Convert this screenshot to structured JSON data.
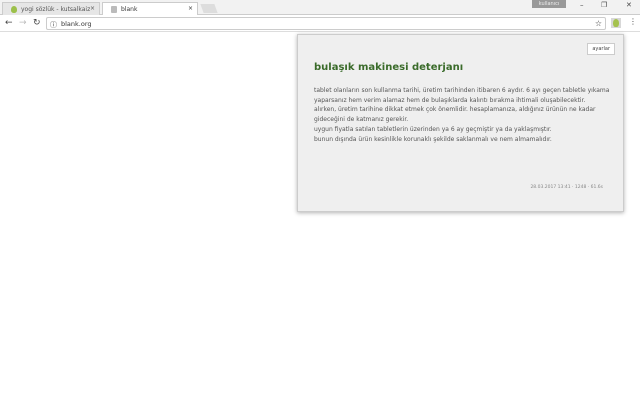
{
  "tabs": [
    {
      "label": "yogi sözlük - kutsalkaiz",
      "close": "×"
    },
    {
      "label": "blank",
      "close": "×"
    }
  ],
  "window": {
    "user": "kullanıcı",
    "minimize": "–",
    "maximize": "❐",
    "close": "✕"
  },
  "toolbar": {
    "back": "←",
    "forward": "→",
    "reload": "↻",
    "url": "blank.org",
    "info": "ⓘ",
    "star": "☆",
    "menu": "⋮"
  },
  "popup": {
    "settings_label": "ayarlar",
    "title": "bulaşık makinesi deterjanı",
    "lines": [
      "tablet olanların son kullanma tarihi, üretim tarihinden itibaren 6 aydır. 6 ayı geçen tabletle yıkama yaparsanız hem verim alamaz hem de bulaşıklarda kalıntı bırakma ihtimali oluşabilecektir.",
      "alırken, üretim tarihine dikkat etmek çok önemlidir. hesaplamanıza, aldığınız ürünün ne kadar gideceğini de katmanız gerekir.",
      "uygun fiyatla satılan tabletlerin üzerinden ya 6 ay geçmiştir ya da yaklaşmıştır.",
      "bunun dışında ürün kesinlikle korunaklı şekilde saklanmalı ve nem almamalıdır."
    ],
    "meta": "28.03.2017 13:41 · 1248 · 61.6s"
  }
}
